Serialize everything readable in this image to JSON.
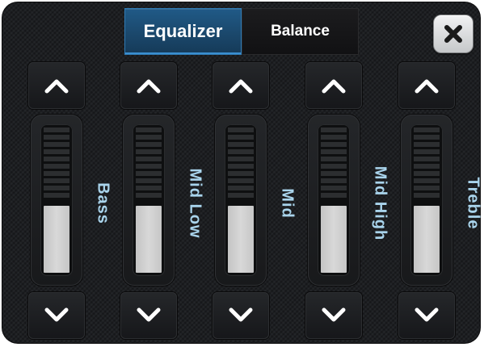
{
  "tabs": [
    {
      "label": "Equalizer",
      "active": true
    },
    {
      "label": "Balance",
      "active": false
    }
  ],
  "close": {
    "icon": "close-icon"
  },
  "bands": [
    {
      "label": "Bass",
      "level": 0.46
    },
    {
      "label": "Mid Low",
      "level": 0.46
    },
    {
      "label": "Mid",
      "level": 0.46
    },
    {
      "label": "Mid High",
      "level": 0.46
    },
    {
      "label": "Treble",
      "level": 0.46
    }
  ],
  "icons": {
    "up": "chevron-up-icon",
    "down": "chevron-down-icon"
  },
  "colors": {
    "accent": "#1f5a88",
    "label": "#a9d4ec",
    "thumb": "#cfcfcf"
  }
}
